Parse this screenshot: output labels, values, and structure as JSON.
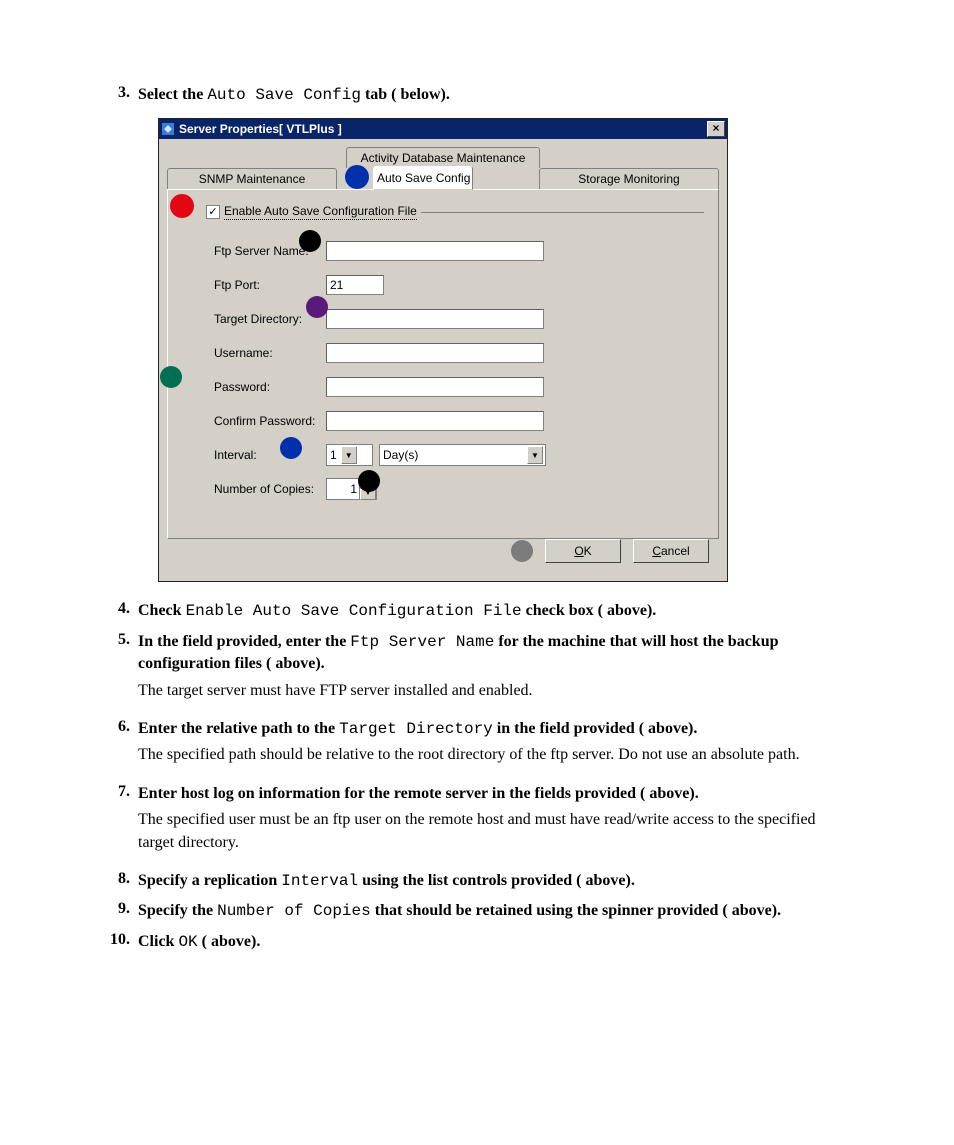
{
  "steps": {
    "s3": {
      "num": "3.",
      "pre": "Select the ",
      "code": "Auto Save Config",
      "post": " tab (   below)."
    },
    "s4": {
      "num": "4.",
      "pre": "Check ",
      "code": "Enable Auto Save Configuration File",
      "post": " check box (   above)."
    },
    "s5": {
      "num": "5.",
      "pre": "In the field provided, enter the ",
      "code": "Ftp Server Name",
      "post": " for the machine that will host the backup configuration files (   above).",
      "para": "The target server must have FTP server installed and enabled."
    },
    "s6": {
      "num": "6.",
      "pre": "Enter the relative path to the ",
      "code": "Target Directory",
      "post": " in the field provided (   above).",
      "para": "The specified path should be relative to the root directory of the ftp server. Do not use an absolute path."
    },
    "s7": {
      "num": "7.",
      "pre": "Enter host log on information for the remote server in the fields provided (   above).",
      "para": "The specified user must be an ftp user on the remote host and must have read/write access to the specified target directory."
    },
    "s8": {
      "num": "8.",
      "pre": "Specify a replication ",
      "code": "Interval",
      "post": " using the list controls provided (   above)."
    },
    "s9": {
      "num": "9.",
      "pre": "Specify the ",
      "code": "Number of Copies",
      "post": " that should be retained using the spinner provided (   above)."
    },
    "s10": {
      "num": "10.",
      "pre": "Click ",
      "code": "OK",
      "post": " (   above)."
    }
  },
  "dialog": {
    "title": "Server Properties[ VTLPlus ]",
    "tabs": {
      "top": "Activity Database Maintenance",
      "left": "SNMP Maintenance",
      "middle": "Auto Save Config",
      "right": "Storage Monitoring"
    },
    "checkbox_label": "Enable Auto Save Configuration File",
    "fields": {
      "ftp_server": {
        "label": "Ftp Server Name:",
        "value": ""
      },
      "ftp_port": {
        "label": "Ftp Port:",
        "value": "21"
      },
      "target_dir": {
        "label": "Target Directory:",
        "value": ""
      },
      "username": {
        "label": "Username:",
        "value": ""
      },
      "password": {
        "label": "Password:",
        "value": ""
      },
      "confirm": {
        "label": "Confirm Password:",
        "value": ""
      },
      "interval": {
        "label": "Interval:",
        "num": "1",
        "unit": "Day(s)"
      },
      "copies": {
        "label": "Number of Copies:",
        "value": "1"
      }
    },
    "buttons": {
      "ok": "OK",
      "cancel": "Cancel",
      "ok_u": "O",
      "ok_rest": "K",
      "cancel_u": "C",
      "cancel_rest": "ancel"
    }
  }
}
